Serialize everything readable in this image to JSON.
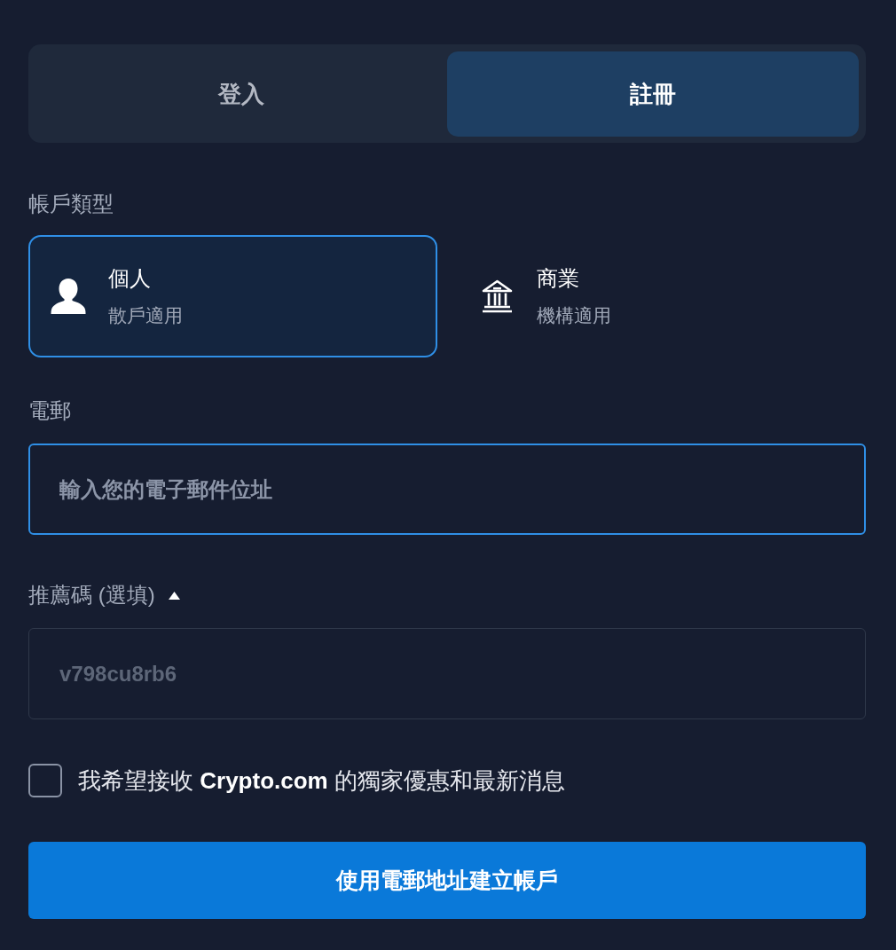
{
  "tabs": [
    {
      "label": "登入",
      "selected": false
    },
    {
      "label": "註冊",
      "selected": true
    }
  ],
  "account_type": {
    "label": "帳戶類型",
    "options": [
      {
        "kind": "personal",
        "title": "個人",
        "subtitle": "散戶適用",
        "selected": true
      },
      {
        "kind": "business",
        "title": "商業",
        "subtitle": "機構適用",
        "selected": false
      }
    ]
  },
  "email": {
    "label": "電郵",
    "placeholder": "輸入您的電子郵件位址",
    "focused": true
  },
  "referral": {
    "label": "推薦碼 (選填)",
    "expanded": true,
    "value": "v798cu8rb6",
    "disabled": true
  },
  "consent": {
    "text": "我希望接收 **Crypto.com** 的獨家優惠和最新消息",
    "checked": false
  },
  "submit": {
    "label": "使用電郵地址建立帳戶"
  }
}
